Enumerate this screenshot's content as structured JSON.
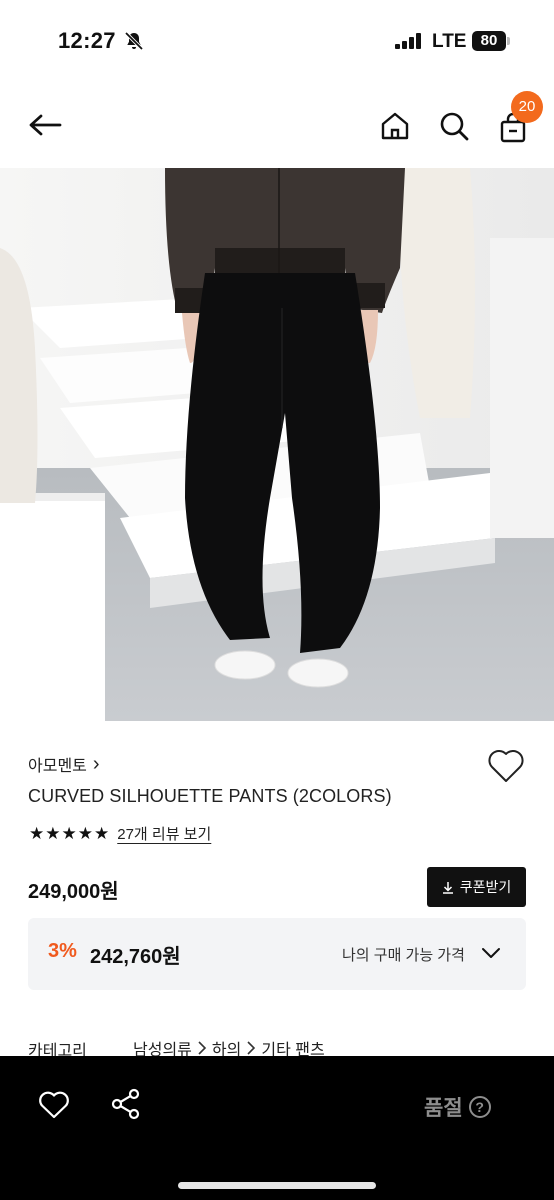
{
  "status_bar": {
    "time": "12:27",
    "network": "LTE",
    "battery": "80"
  },
  "nav": {
    "cart_count": "20"
  },
  "product": {
    "brand": "아모멘토",
    "brand_chevron": "›",
    "title": "CURVED SILHOUETTE PANTS (2COLORS)",
    "rating_stars": 5,
    "review_link": "27개 리뷰 보기",
    "price": "249,000원",
    "coupon_button": "쿠폰받기",
    "discount_rate": "3%",
    "discount_price": "242,760원",
    "my_price_label": "나의 구매 가능 가격"
  },
  "category": {
    "label": "카테고리",
    "path": [
      "남성의류",
      "하의",
      "기타 팬츠"
    ]
  },
  "bottom_bar": {
    "soldout_label": "품절",
    "help": "?"
  },
  "colors": {
    "accent": "#f36a1d",
    "discount": "#f05a1e",
    "bottom_bar": "#000000"
  }
}
